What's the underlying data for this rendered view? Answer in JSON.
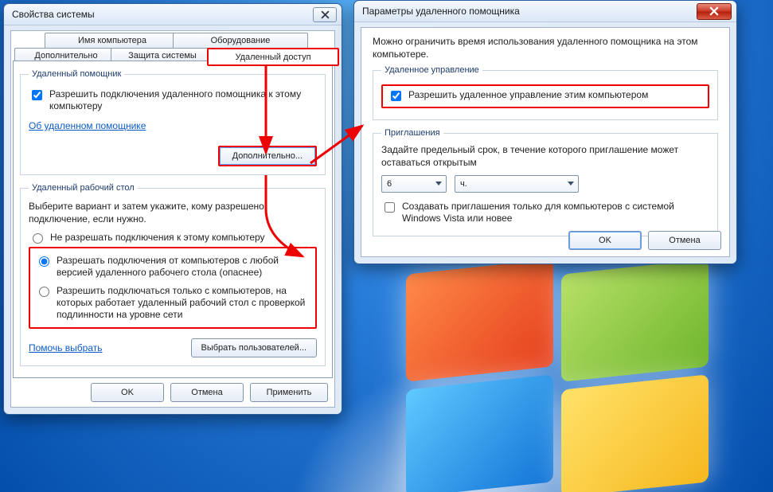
{
  "colors": {
    "highlight": "#e00000",
    "link": "#0a5bcc"
  },
  "sysprops": {
    "title": "Свойства системы",
    "tabs": {
      "computer_name": "Имя компьютера",
      "hardware": "Оборудование",
      "advanced": "Дополнительно",
      "system_protection": "Защита системы",
      "remote": "Удаленный доступ"
    },
    "assistant_group": {
      "legend": "Удаленный помощник",
      "allow_checkbox": "Разрешить подключения удаленного помощника к этому компьютеру",
      "about_link": "Об удаленном помощнике",
      "advanced_button": "Дополнительно..."
    },
    "rdp_group": {
      "legend": "Удаленный рабочий стол",
      "intro": "Выберите вариант и затем укажите, кому разрешено подключение, если нужно.",
      "opt_none": "Не разрешать подключения к этому компьютеру",
      "opt_any": "Разрешать подключения от компьютеров с любой версией удаленного рабочего стола (опаснее)",
      "opt_nla": "Разрешить подключаться только с компьютеров, на которых работает удаленный рабочий стол с проверкой подлинности на уровне сети",
      "help_link": "Помочь выбрать",
      "select_users_button": "Выбрать пользователей..."
    },
    "buttons": {
      "ok": "OK",
      "cancel": "Отмена",
      "apply": "Применить"
    }
  },
  "assistant": {
    "title": "Параметры удаленного помощника",
    "intro": "Можно ограничить время использования удаленного помощника на этом компьютере.",
    "control_group": {
      "legend": "Удаленное управление",
      "allow_checkbox": "Разрешить удаленное управление этим компьютером"
    },
    "invite_group": {
      "legend": "Приглашения",
      "prompt": "Задайте предельный срок, в течение которого приглашение может оставаться открытым",
      "value": "6",
      "unit": "ч.",
      "vista_only": "Создавать приглашения только для компьютеров с системой Windows Vista или новее"
    },
    "buttons": {
      "ok": "OK",
      "cancel": "Отмена"
    }
  }
}
